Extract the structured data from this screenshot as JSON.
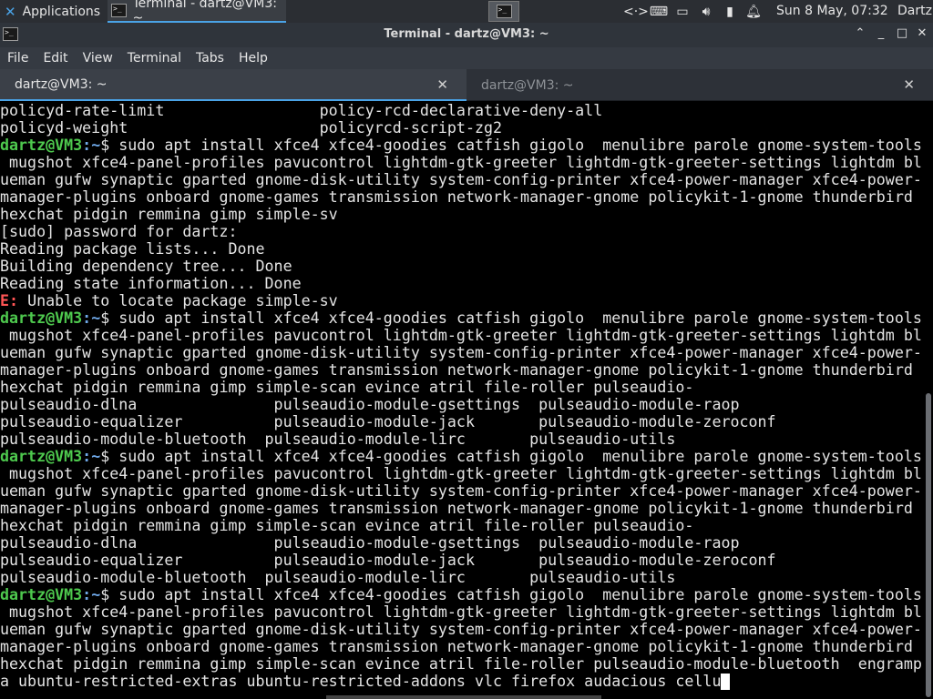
{
  "panel": {
    "apps_label": "Applications",
    "apps_separator": "⋮",
    "task_label": "Terminal - dartz@VM3: ~",
    "clock": "Sun  8 May, 07:32",
    "user": "Dartz",
    "tray_icons": [
      "code-icon",
      "keyboard-icon",
      "display-icon",
      "volume-icon",
      "battery-icon",
      "bell-icon"
    ]
  },
  "window": {
    "title": "Terminal - dartz@VM3: ~",
    "minimize": "⌃",
    "maximize": "□",
    "close": "✕"
  },
  "menu": [
    "File",
    "Edit",
    "View",
    "Terminal",
    "Tabs",
    "Help"
  ],
  "tabs": [
    {
      "label": "dartz@VM3: ~",
      "active": true
    },
    {
      "label": "dartz@VM3: ~",
      "active": false
    }
  ],
  "terminal": {
    "prompt_user": "dartz@VM3",
    "prompt_path": ":~",
    "lines": [
      {
        "type": "text",
        "text": "policyd-rate-limit                 policy-rcd-declarative-deny-all"
      },
      {
        "type": "text",
        "text": "policyd-weight                     policyrcd-script-zg2"
      },
      {
        "type": "prompt",
        "text": "$ sudo apt install xfce4 xfce4-goodies catfish gigolo  menulibre parole gnome-system-tools"
      },
      {
        "type": "text",
        "text": " mugshot xfce4-panel-profiles pavucontrol lightdm-gtk-greeter lightdm-gtk-greeter-settings lightdm bl"
      },
      {
        "type": "text",
        "text": "ueman gufw synaptic gparted gnome-disk-utility system-config-printer xfce4-power-manager xfce4-power-"
      },
      {
        "type": "text",
        "text": "manager-plugins onboard gnome-games transmission network-manager-gnome policykit-1-gnome thunderbird"
      },
      {
        "type": "text",
        "text": "hexchat pidgin remmina gimp simple-sv"
      },
      {
        "type": "text",
        "text": "[sudo] password for dartz:"
      },
      {
        "type": "text",
        "text": "Reading package lists... Done"
      },
      {
        "type": "text",
        "text": "Building dependency tree... Done"
      },
      {
        "type": "text",
        "text": "Reading state information... Done"
      },
      {
        "type": "error",
        "prefix": "E:",
        "text": " Unable to locate package simple-sv"
      },
      {
        "type": "prompt",
        "text": "$ sudo apt install xfce4 xfce4-goodies catfish gigolo  menulibre parole gnome-system-tools"
      },
      {
        "type": "text",
        "text": " mugshot xfce4-panel-profiles pavucontrol lightdm-gtk-greeter lightdm-gtk-greeter-settings lightdm bl"
      },
      {
        "type": "text",
        "text": "ueman gufw synaptic gparted gnome-disk-utility system-config-printer xfce4-power-manager xfce4-power-"
      },
      {
        "type": "text",
        "text": "manager-plugins onboard gnome-games transmission network-manager-gnome policykit-1-gnome thunderbird"
      },
      {
        "type": "text",
        "text": "hexchat pidgin remmina gimp simple-scan evince atril file-roller pulseaudio-"
      },
      {
        "type": "text",
        "text": "pulseaudio-dlna               pulseaudio-module-gsettings  pulseaudio-module-raop"
      },
      {
        "type": "text",
        "text": "pulseaudio-equalizer          pulseaudio-module-jack       pulseaudio-module-zeroconf"
      },
      {
        "type": "text",
        "text": "pulseaudio-module-bluetooth  pulseaudio-module-lirc       pulseaudio-utils"
      },
      {
        "type": "prompt",
        "text": "$ sudo apt install xfce4 xfce4-goodies catfish gigolo  menulibre parole gnome-system-tools"
      },
      {
        "type": "text",
        "text": " mugshot xfce4-panel-profiles pavucontrol lightdm-gtk-greeter lightdm-gtk-greeter-settings lightdm bl"
      },
      {
        "type": "text",
        "text": "ueman gufw synaptic gparted gnome-disk-utility system-config-printer xfce4-power-manager xfce4-power-"
      },
      {
        "type": "text",
        "text": "manager-plugins onboard gnome-games transmission network-manager-gnome policykit-1-gnome thunderbird"
      },
      {
        "type": "text",
        "text": "hexchat pidgin remmina gimp simple-scan evince atril file-roller pulseaudio-"
      },
      {
        "type": "text",
        "text": "pulseaudio-dlna               pulseaudio-module-gsettings  pulseaudio-module-raop"
      },
      {
        "type": "text",
        "text": "pulseaudio-equalizer          pulseaudio-module-jack       pulseaudio-module-zeroconf"
      },
      {
        "type": "text",
        "text": "pulseaudio-module-bluetooth  pulseaudio-module-lirc       pulseaudio-utils"
      },
      {
        "type": "prompt",
        "text": "$ sudo apt install xfce4 xfce4-goodies catfish gigolo  menulibre parole gnome-system-tools"
      },
      {
        "type": "text",
        "text": " mugshot xfce4-panel-profiles pavucontrol lightdm-gtk-greeter lightdm-gtk-greeter-settings lightdm bl"
      },
      {
        "type": "text",
        "text": "ueman gufw synaptic gparted gnome-disk-utility system-config-printer xfce4-power-manager xfce4-power-"
      },
      {
        "type": "text",
        "text": "manager-plugins onboard gnome-games transmission network-manager-gnome policykit-1-gnome thunderbird"
      },
      {
        "type": "text",
        "text": "hexchat pidgin remmina gimp simple-scan evince atril file-roller pulseaudio-module-bluetooth  engramp"
      },
      {
        "type": "input",
        "text": "a ubuntu-restricted-extras ubuntu-restricted-addons vlc firefox audacious cellu"
      }
    ]
  }
}
